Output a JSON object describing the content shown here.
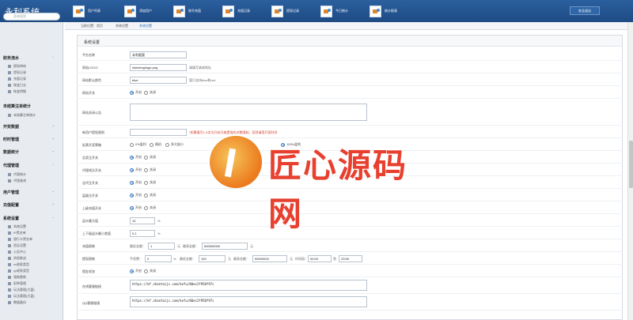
{
  "app": {
    "title": "永利系统"
  },
  "topnav": {
    "items": [
      "用户列表",
      "添加用户",
      "账号充值",
      "充值记录",
      "提现记录",
      "今日统计",
      "统计报表"
    ],
    "logout": "安全退出"
  },
  "sidebar": {
    "search_placeholder": "菜单搜索",
    "sections": [
      {
        "title": "财务流水",
        "items": [
          "提现审核",
          "提现记录",
          "充值记录",
          "账变日志",
          "帐变明细"
        ]
      },
      {
        "title": "未结算注单统计",
        "items": [
          "未结算注单统计"
        ]
      },
      {
        "title": "开奖数据",
        "items": []
      },
      {
        "title": "时时管理",
        "items": []
      },
      {
        "title": "数据统计",
        "items": []
      },
      {
        "title": "代理管理",
        "items": [
          "代理统计",
          "代理查询"
        ]
      },
      {
        "title": "用户管理",
        "items": []
      },
      {
        "title": "充值配置",
        "items": []
      },
      {
        "title": "系统设置",
        "items": [
          "系统设置",
          "IP黑名单",
          "银行卡黑名单",
          "验证设置",
          "公告中心",
          "消息推送",
          "xx收款类型",
          "yy收款类型",
          "强制更新",
          "彩种管理",
          "玩法管理(大盘)",
          "玩法管理(大盘)",
          "数据备份"
        ]
      }
    ]
  },
  "breadcrumb": [
    "当前位置：首页",
    "系统设置",
    "系统设置"
  ],
  "panel": {
    "title": "系统设置"
  },
  "form": {
    "platform_name": {
      "label": "平台名称",
      "value": "永利星宸"
    },
    "logo": {
      "label": "网站LOGO",
      "value": "/skin/img/logo.png",
      "hint": "请填写具体地址"
    },
    "default_color": {
      "label": "网站默认颜色",
      "value": "blue",
      "hint": "暂只支持blue和red"
    },
    "site_switch": {
      "label": "网站开关",
      "on": "开启",
      "off": "关闭"
    },
    "close_notice": {
      "label": "网站关闭公告"
    },
    "draw_notice": {
      "label": "新用户提现规则",
      "warn": "*如需填写1-5次为开启开放提现的次数限制，否则请用开奖时间"
    },
    "draw_rules": {
      "label": "彩票开奖策略",
      "options": [
        "0%盈利",
        "随机",
        "多大赔小",
        "100%盈利"
      ]
    },
    "ranking_switch": {
      "label": "总奖注开关",
      "on": "开启",
      "off": "关闭"
    },
    "agent_reg": {
      "label": "代理线注开关",
      "on": "开启",
      "off": "关闭"
    },
    "member_reg": {
      "label": "总代注开关",
      "on": "开启",
      "off": "关闭"
    },
    "lucky_switch": {
      "label": "层级注开关",
      "on": "开启",
      "off": "关闭"
    },
    "online_switch": {
      "label": "上级充值开关",
      "on": "开启",
      "off": "关闭"
    },
    "max_ratio": {
      "label": "返水最大值",
      "value": "10",
      "unit": "%"
    },
    "min_ratio": {
      "label": "上下级返水最小差值",
      "value": "0.1",
      "unit": "%"
    },
    "recharge_limit": {
      "label": "充值限制",
      "min_label": "最低金额：",
      "min": "1",
      "max_label": "最高金额：",
      "max": "500000000",
      "unit": "元"
    },
    "withdraw_limit": {
      "label": "提现限制",
      "fee_label": "手续费：",
      "fee": "0",
      "min_label": "最低金额：",
      "min": "100",
      "max_label": "最高金额：",
      "max": "50000000",
      "time_label": "时间段：从",
      "time_from": "00:00",
      "time_to": "23:59"
    },
    "withdraw_switch": {
      "label": "佣金状态",
      "on": "开启",
      "off": "关闭"
    },
    "service_url": {
      "label": "在线客服链接",
      "value": "https://kf.zhantaijc.com/kefu/80ec2f950f97c"
    },
    "qq_url": {
      "label": "QQ客服链接",
      "value": "https://kf.zhantaijc.com/kefu/80ec2f950f97c"
    }
  },
  "watermark": {
    "text": "匠心源码网"
  }
}
